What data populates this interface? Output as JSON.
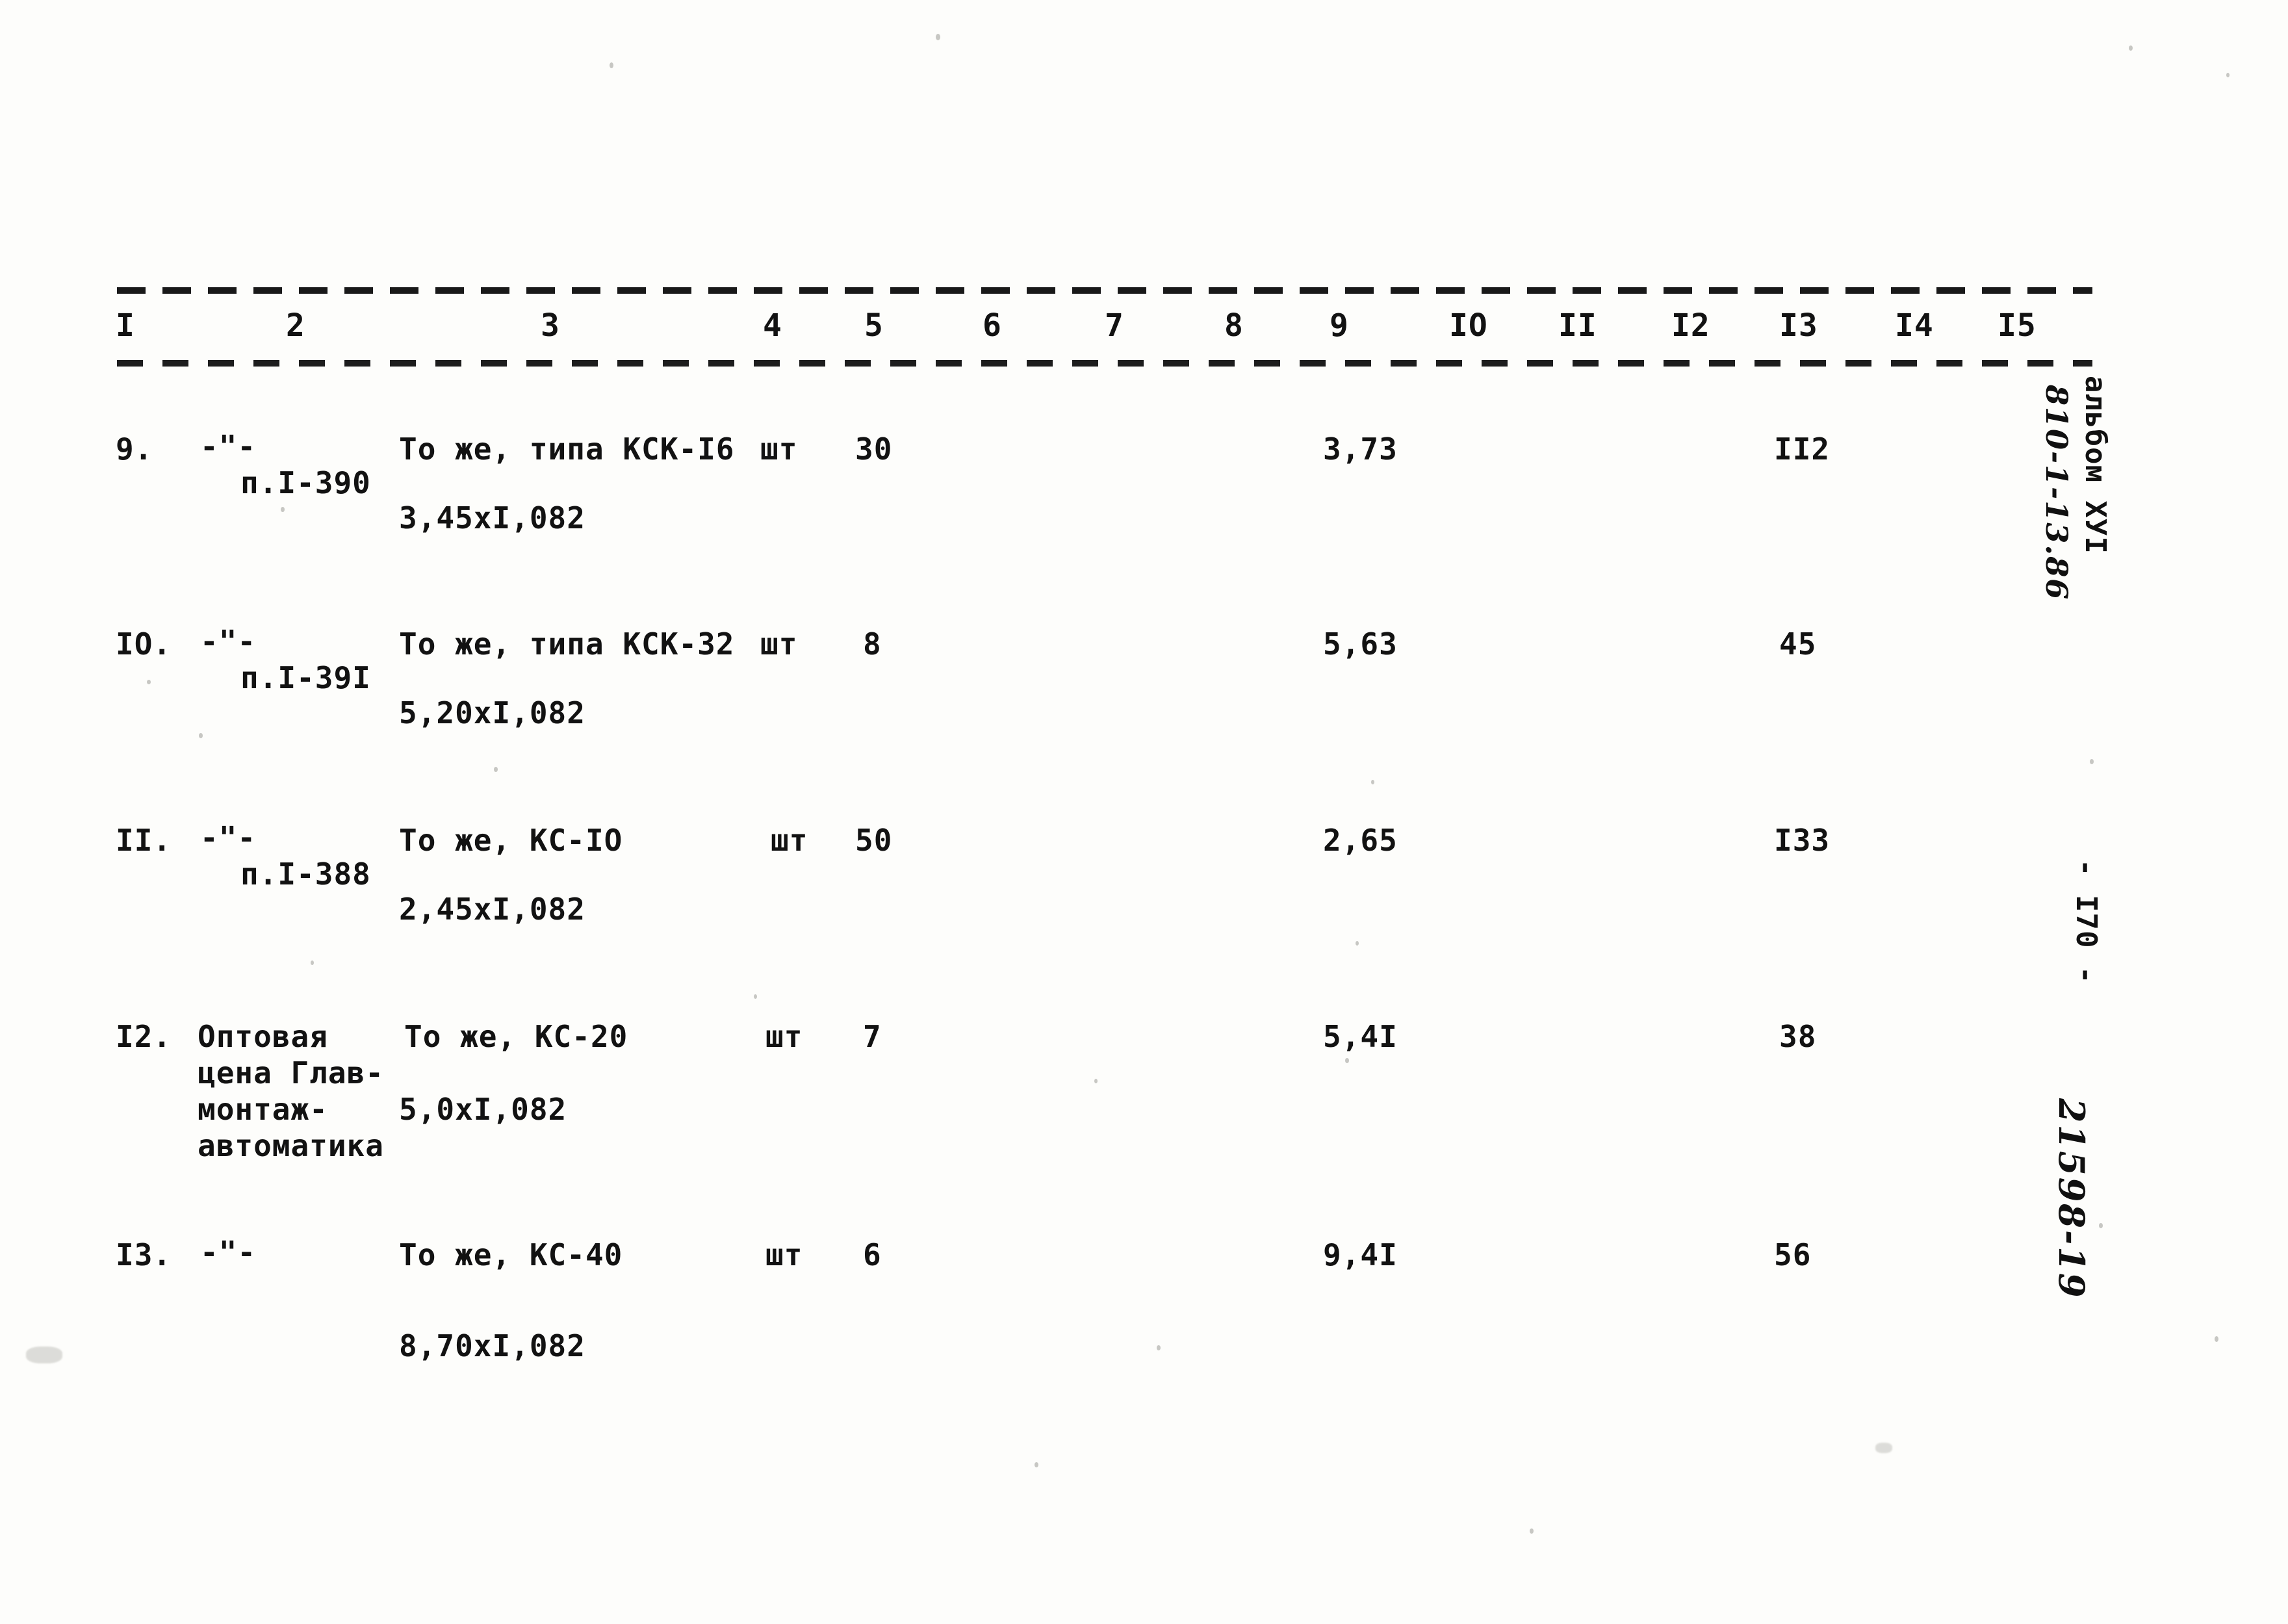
{
  "document": {
    "kind": "scanned-typewritten-price-table",
    "page_number_margin": "- I70 -",
    "album_margin": "альбом ХУI",
    "album_code_handwritten": "810-1-13.86",
    "archive_code_handwritten": "21598-19"
  },
  "table": {
    "column_headers": [
      "I",
      "2",
      "3",
      "4",
      "5",
      "6",
      "7",
      "8",
      "9",
      "IO",
      "II",
      "I2",
      "I3",
      "I4",
      "I5"
    ],
    "rows": [
      {
        "num": "9.",
        "col2_lines": [
          "-\"-",
          "п.I-390"
        ],
        "col3_lines": [
          "То же, типа КСК-I6",
          "3,45хI,082"
        ],
        "unit": "шт",
        "qty": "30",
        "col9": "3,73",
        "col13": "II2"
      },
      {
        "num": "IO.",
        "col2_lines": [
          "-\"-",
          "п.I-39I"
        ],
        "col3_lines": [
          "То же, типа КСК-32",
          "5,20хI,082"
        ],
        "unit": "шт",
        "qty": "8",
        "col9": "5,63",
        "col13": "45"
      },
      {
        "num": "II.",
        "col2_lines": [
          "-\"-",
          "п.I-388"
        ],
        "col3_lines": [
          "То же, КС-IO",
          "2,45хI,082"
        ],
        "unit": "шт",
        "qty": "50",
        "col9": "2,65",
        "col13": "I33"
      },
      {
        "num": "I2.",
        "col2_lines": [
          "Оптовая",
          "цена Глав-",
          "монтаж-",
          "автоматика"
        ],
        "col3_lines": [
          "То же, КС-20",
          "5,0хI,082"
        ],
        "unit": "шт",
        "qty": "7",
        "col9": "5,4I",
        "col13": "38"
      },
      {
        "num": "I3.",
        "col2_lines": [
          "-\"-"
        ],
        "col3_lines": [
          "То же, КС-40",
          "8,70хI,082"
        ],
        "unit": "шт",
        "qty": "6",
        "col9": "9,4I",
        "col13": "56"
      }
    ]
  }
}
